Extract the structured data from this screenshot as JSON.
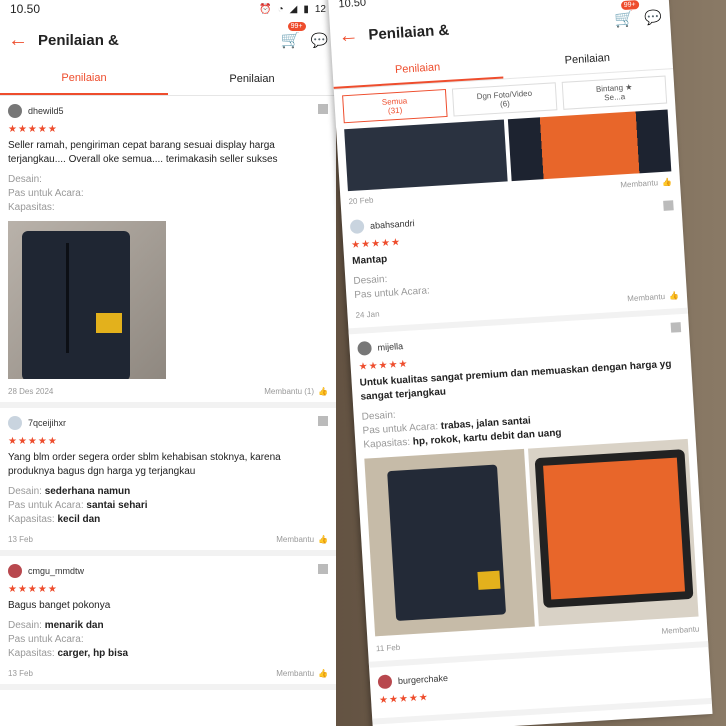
{
  "left": {
    "status": {
      "time": "10.50",
      "battery": "12"
    },
    "header": {
      "title": "Penilaian &",
      "cart_badge": "99+"
    },
    "tabs": [
      {
        "label": "Penilaian"
      },
      {
        "label": "Penilaian"
      }
    ],
    "reviews": [
      {
        "user": "dhewild5",
        "stars": "★★★★★",
        "text": "Seller ramah, pengiriman cepat barang sesuai display harga terjangkau.... Overall oke semua.... terimakasih seller sukses",
        "desain_label": "Desain:",
        "desain_value": "",
        "acara_label": "Pas untuk Acara:",
        "acara_value": "",
        "kapasitas_label": "Kapasitas:",
        "kapasitas_value": "",
        "date": "28 Des 2024",
        "helpful": "Membantu (1)"
      },
      {
        "user": "7qceijihxr",
        "stars": "★★★★★",
        "text": "Yang blm order segera order sblm kehabisan stoknya, karena produknya bagus dgn harga yg terjangkau",
        "desain_label": "Desain:",
        "desain_value": "sederhana namun",
        "acara_label": "Pas untuk Acara:",
        "acara_value": "santai sehari",
        "kapasitas_label": "Kapasitas:",
        "kapasitas_value": "kecil dan",
        "date": "13 Feb",
        "helpful": "Membantu"
      },
      {
        "user": "cmgu_mmdtw",
        "stars": "★★★★★",
        "text": "Bagus banget pokonya",
        "desain_label": "Desain:",
        "desain_value": "menarik dan",
        "acara_label": "Pas untuk Acara:",
        "acara_value": "",
        "kapasitas_label": "Kapasitas:",
        "kapasitas_value": "carger, hp bisa",
        "date": "13 Feb",
        "helpful": "Membantu"
      }
    ]
  },
  "right": {
    "status": {
      "time": "10.50"
    },
    "header": {
      "title": "Penilaian &",
      "cart_badge": "99+"
    },
    "tabs": [
      {
        "label": "Penilaian"
      },
      {
        "label": "Penilaian"
      }
    ],
    "filters": [
      {
        "label": "Semua",
        "count": "(31)"
      },
      {
        "label": "Dgn Foto/Video",
        "count": "(6)"
      },
      {
        "label": "Bintang ★",
        "count": "Se...a"
      }
    ],
    "first": {
      "date": "20 Feb",
      "helpful": "Membantu"
    },
    "second": {
      "user": "abahsandri",
      "stars": "★★★★★",
      "text": "Mantap",
      "desain_label": "Desain:",
      "acara_label": "Pas untuk Acara:",
      "date": "24 Jan",
      "helpful": "Membantu"
    },
    "third": {
      "user": "mijella",
      "stars": "★★★★★",
      "text": "Untuk kualitas sangat premium dan memuaskan dengan harga yg sangat terjangkau",
      "desain_label": "Desain:",
      "acara_label": "Pas untuk Acara:",
      "acara_value": "trabas, jalan santai",
      "kapasitas_label": "Kapasitas:",
      "kapasitas_value": "hp, rokok, kartu debit dan uang",
      "date": "11 Feb",
      "helpful": "Membantu"
    },
    "fourth": {
      "user": "burgerchake",
      "stars": "★★★★★"
    }
  }
}
